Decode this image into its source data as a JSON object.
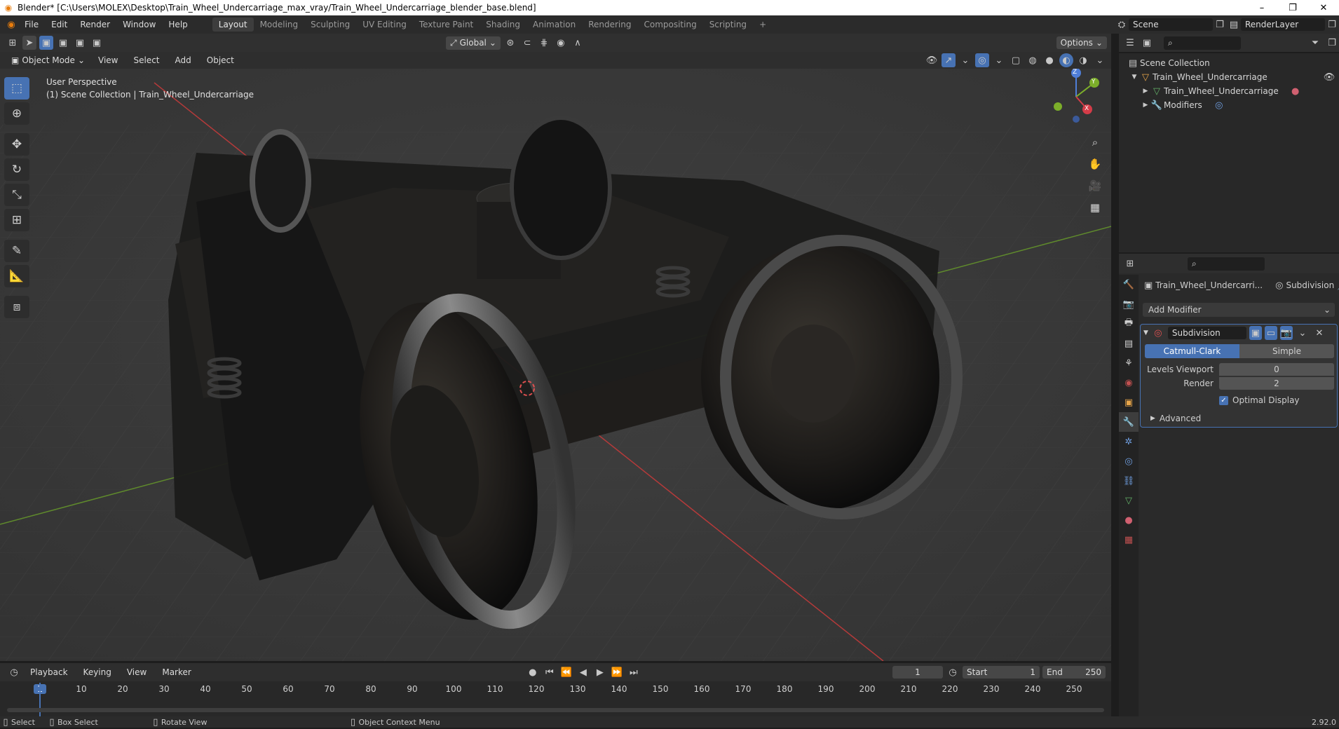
{
  "window": {
    "title": "Blender* [C:\\Users\\MOLEX\\Desktop\\Train_Wheel_Undercarriage_max_vray/Train_Wheel_Undercarriage_blender_base.blend]",
    "minimize": "–",
    "maximize": "❐",
    "close": "✕"
  },
  "menu": {
    "items": [
      "File",
      "Edit",
      "Render",
      "Window",
      "Help"
    ],
    "workspaces": [
      "Layout",
      "Modeling",
      "Sculpting",
      "UV Editing",
      "Texture Paint",
      "Shading",
      "Animation",
      "Rendering",
      "Compositing",
      "Scripting"
    ],
    "active_workspace": "Layout",
    "add_workspace": "+",
    "scene": "Scene",
    "render_layer": "RenderLayer"
  },
  "toolbar": {
    "orientation": "Global",
    "options": "Options"
  },
  "viewport_header": {
    "mode": "Object Mode",
    "menus": [
      "View",
      "Select",
      "Add",
      "Object"
    ]
  },
  "viewport": {
    "perspective": "User Perspective",
    "collection_info": "(1) Scene Collection | Train_Wheel_Undercarriage",
    "gizmo": {
      "z": "Z",
      "y": "Y",
      "x": "X"
    }
  },
  "outliner": {
    "root": "Scene Collection",
    "items": [
      {
        "label": "Train_Wheel_Undercarriage",
        "level": 1
      },
      {
        "label": "Train_Wheel_Undercarriage",
        "level": 2
      },
      {
        "label": "Modifiers",
        "level": 2
      }
    ]
  },
  "properties": {
    "object_name": "Train_Wheel_Undercarri...",
    "modifier_label": "Subdivision",
    "add_modifier": "Add Modifier",
    "modifier": {
      "name": "Subdivision",
      "type_options": [
        "Catmull-Clark",
        "Simple"
      ],
      "active_type": "Catmull-Clark",
      "levels_viewport_label": "Levels Viewport",
      "levels_viewport": "0",
      "render_label": "Render",
      "render": "2",
      "optimal_display_label": "Optimal Display",
      "optimal_display": true,
      "advanced_label": "Advanced"
    }
  },
  "timeline": {
    "menus": [
      "Playback",
      "Keying",
      "View",
      "Marker"
    ],
    "current_frame": "1",
    "start_label": "Start",
    "start": "1",
    "end_label": "End",
    "end": "250",
    "ticks": [
      "1",
      "10",
      "20",
      "30",
      "40",
      "50",
      "60",
      "70",
      "80",
      "90",
      "100",
      "110",
      "120",
      "130",
      "140",
      "150",
      "160",
      "170",
      "180",
      "190",
      "200",
      "210",
      "220",
      "230",
      "240",
      "250"
    ]
  },
  "status": {
    "select": "Select",
    "box_select": "Box Select",
    "rotate_view": "Rotate View",
    "context_menu": "Object Context Menu",
    "version": "2.92.0"
  },
  "colors": {
    "accent": "#4772b3",
    "viewport": "#3a3a3a",
    "panel": "#282828"
  }
}
